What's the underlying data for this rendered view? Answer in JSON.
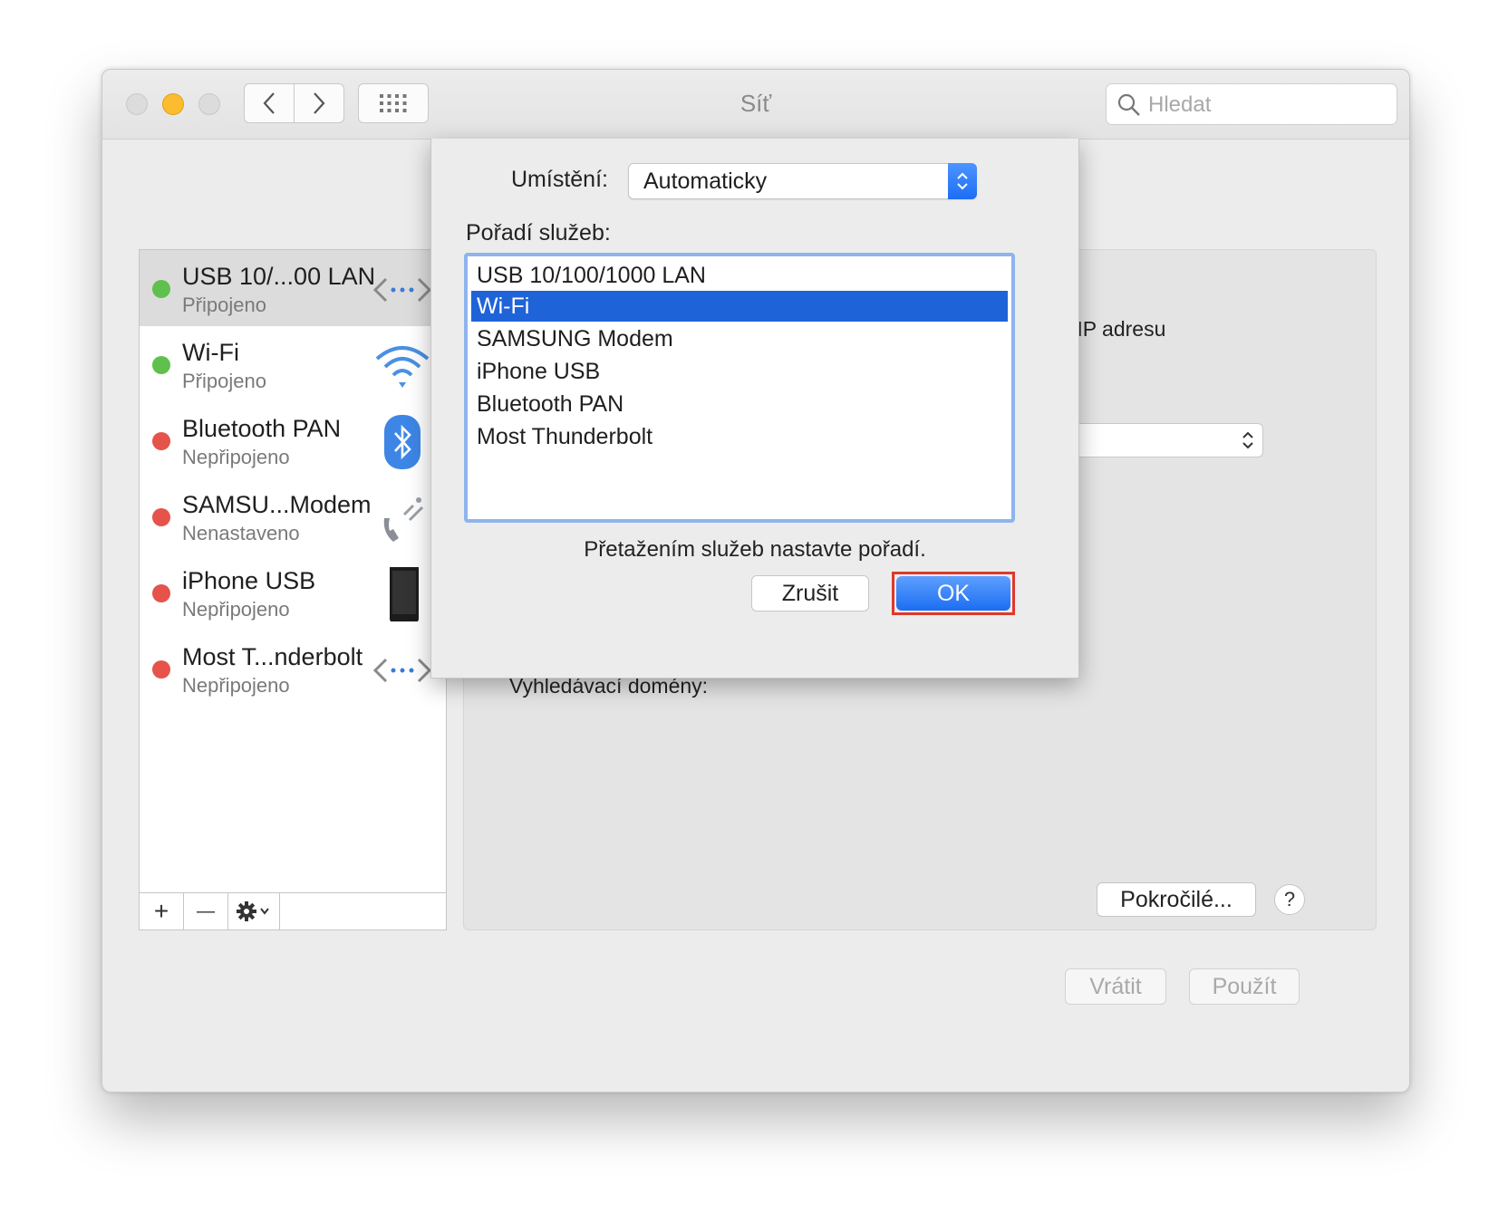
{
  "window": {
    "title": "Síť",
    "search_placeholder": "Hledat"
  },
  "sidebar": {
    "items": [
      {
        "name": "USB 10/...00 LAN",
        "status": "Připojeno",
        "status_color": "#5fc04d",
        "icon": "ethernet-icon"
      },
      {
        "name": "Wi-Fi",
        "status": "Připojeno",
        "status_color": "#5fc04d",
        "icon": "wifi-icon"
      },
      {
        "name": "Bluetooth PAN",
        "status": "Nepřipojeno",
        "status_color": "#e5534b",
        "icon": "bluetooth-icon"
      },
      {
        "name": "SAMSU...Modem",
        "status": "Nenastaveno",
        "status_color": "#e5534b",
        "icon": "phone-modem-icon"
      },
      {
        "name": "iPhone USB",
        "status": "Nepřipojeno",
        "status_color": "#e5534b",
        "icon": "iphone-icon"
      },
      {
        "name": "Most T...nderbolt",
        "status": "Nepřipojeno",
        "status_color": "#e5534b",
        "icon": "thunderbolt-bridge-icon"
      }
    ],
    "toolbar": {
      "add": "+",
      "remove": "—"
    }
  },
  "detail": {
    "ip_text_fragment": "má IP adresu",
    "search_domains_label": "Vyhledávací domény:",
    "advanced_button": "Pokročilé...",
    "help_button": "?",
    "revert_button": "Vrátit",
    "apply_button": "Použít"
  },
  "sheet": {
    "location_label": "Umístění:",
    "location_value": "Automaticky",
    "order_label": "Pořadí služeb:",
    "services": [
      {
        "label": "USB 10/100/1000 LAN",
        "selected": false
      },
      {
        "label": "Wi-Fi",
        "selected": true
      },
      {
        "label": "SAMSUNG Modem",
        "selected": false
      },
      {
        "label": "iPhone USB",
        "selected": false
      },
      {
        "label": "Bluetooth PAN",
        "selected": false
      },
      {
        "label": "Most Thunderbolt",
        "selected": false
      }
    ],
    "hint": "Přetažením služeb nastavte pořadí.",
    "cancel_button": "Zrušit",
    "ok_button": "OK"
  },
  "colors": {
    "accent_blue": "#1f63d8",
    "highlight_red": "#e0382b"
  }
}
